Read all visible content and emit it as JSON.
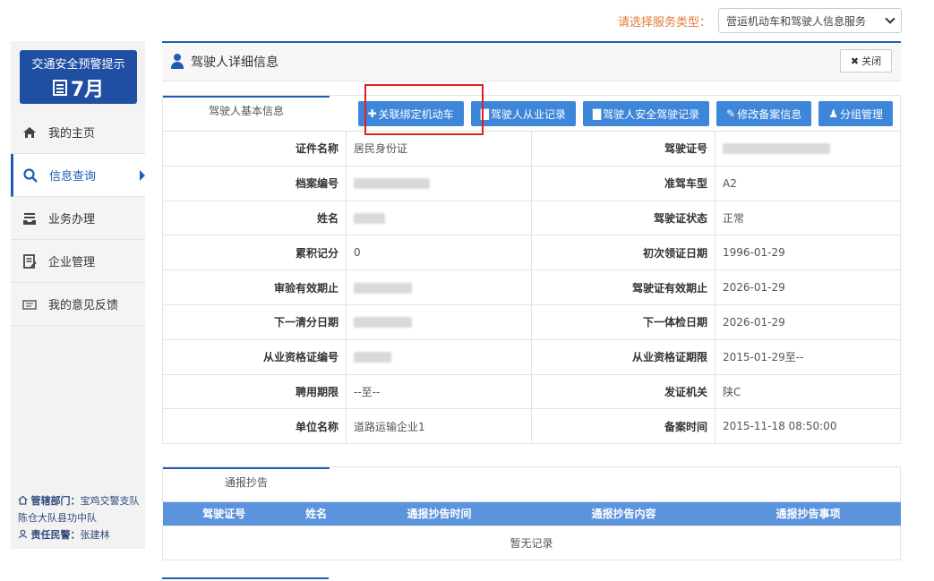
{
  "service": {
    "label": "请选择服务类型：",
    "selected": "营运机动车和驾驶人信息服务"
  },
  "sidebar": {
    "alert_title": "交通安全预警提示",
    "alert_month": "7月",
    "items": [
      {
        "label": "我的主页"
      },
      {
        "label": "信息查询"
      },
      {
        "label": "业务办理"
      },
      {
        "label": "企业管理"
      },
      {
        "label": "我的意见反馈"
      }
    ],
    "dept_label": "管辖部门：",
    "dept_value": "宝鸡交警支队陈仓大队县功中队",
    "officer_label": "责任民警：",
    "officer_value": "张建林"
  },
  "panel": {
    "title": "驾驶人详细信息",
    "close": "关闭",
    "tab": "驾驶人基本信息",
    "buttons": [
      "关联绑定机动车",
      "驾驶人从业记录",
      "驾驶人安全驾驶记录",
      "修改备案信息",
      "分组管理"
    ]
  },
  "info": {
    "rows": [
      {
        "k1": "证件名称",
        "v1": "居民身份证",
        "k2": "驾驶证号",
        "v2": ""
      },
      {
        "k1": "档案编号",
        "v1": "",
        "k2": "准驾车型",
        "v2": "A2"
      },
      {
        "k1": "姓名",
        "v1": "",
        "k2": "驾驶证状态",
        "v2": "正常"
      },
      {
        "k1": "累积记分",
        "v1": "0",
        "k2": "初次领证日期",
        "v2": "1996-01-29"
      },
      {
        "k1": "审验有效期止",
        "v1": "",
        "k2": "驾驶证有效期止",
        "v2": "2026-01-29"
      },
      {
        "k1": "下一清分日期",
        "v1": "",
        "k2": "下一体检日期",
        "v2": "2026-01-29"
      },
      {
        "k1": "从业资格证编号",
        "v1": "",
        "k2": "从业资格证期限",
        "v2": "2015-01-29至--"
      },
      {
        "k1": "聘用期限",
        "v1": "--至--",
        "k2": "发证机关",
        "v2": "陕C"
      },
      {
        "k1": "单位名称",
        "v1": "道路运输企业1",
        "k2": "备案时间",
        "v2": "2015-11-18 08:50:00"
      }
    ]
  },
  "notice": {
    "tab": "通报抄告",
    "columns": [
      "驾驶证号",
      "姓名",
      "通报抄告时间",
      "通报抄告内容",
      "通报抄告事项"
    ],
    "empty": "暂无记录"
  }
}
